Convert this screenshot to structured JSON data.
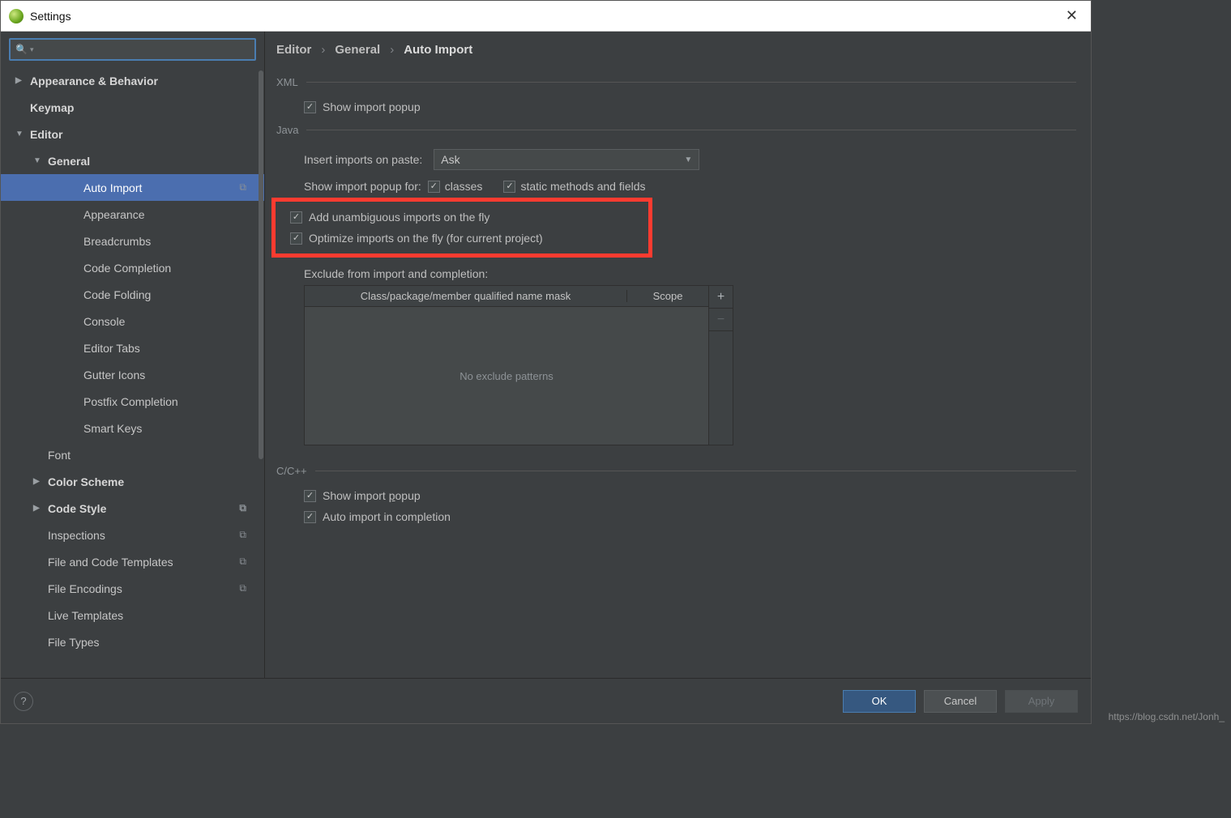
{
  "window": {
    "title": "Settings"
  },
  "breadcrumb": {
    "a": "Editor",
    "b": "General",
    "c": "Auto Import"
  },
  "sidebar": {
    "items": [
      {
        "label": "Appearance & Behavior",
        "bold": true,
        "arrow": "▶",
        "lvl": 0
      },
      {
        "label": "Keymap",
        "bold": true,
        "lvl": 0
      },
      {
        "label": "Editor",
        "bold": true,
        "arrow": "▼",
        "lvl": 0
      },
      {
        "label": "General",
        "bold": true,
        "arrow": "▼",
        "lvl": 1
      },
      {
        "label": "Auto Import",
        "lvl": 3,
        "selected": true,
        "proj": true
      },
      {
        "label": "Appearance",
        "lvl": 3
      },
      {
        "label": "Breadcrumbs",
        "lvl": 3
      },
      {
        "label": "Code Completion",
        "lvl": 3
      },
      {
        "label": "Code Folding",
        "lvl": 3
      },
      {
        "label": "Console",
        "lvl": 3
      },
      {
        "label": "Editor Tabs",
        "lvl": 3
      },
      {
        "label": "Gutter Icons",
        "lvl": 3
      },
      {
        "label": "Postfix Completion",
        "lvl": 3
      },
      {
        "label": "Smart Keys",
        "lvl": 3
      },
      {
        "label": "Font",
        "lvl": 1
      },
      {
        "label": "Color Scheme",
        "bold": true,
        "arrow": "▶",
        "lvl": 1
      },
      {
        "label": "Code Style",
        "bold": true,
        "arrow": "▶",
        "lvl": 1,
        "proj": true
      },
      {
        "label": "Inspections",
        "lvl": 1,
        "proj": true
      },
      {
        "label": "File and Code Templates",
        "lvl": 1,
        "proj": true
      },
      {
        "label": "File Encodings",
        "lvl": 1,
        "proj": true
      },
      {
        "label": "Live Templates",
        "lvl": 1
      },
      {
        "label": "File Types",
        "lvl": 1
      }
    ]
  },
  "xml": {
    "title": "XML",
    "show_import_popup": "Show import popup"
  },
  "java": {
    "title": "Java",
    "insert_label": "Insert imports on paste:",
    "insert_value": "Ask",
    "show_for_label": "Show import popup for:",
    "classes": "classes",
    "static": "static methods and fields",
    "unambig": "Add unambiguous imports on the fly",
    "optimize": "Optimize imports on the fly (for current project)",
    "exclude_label": "Exclude from import and completion:",
    "col1": "Class/package/member qualified name mask",
    "col2": "Scope",
    "empty": "No exclude patterns"
  },
  "cpp": {
    "title": "C/C++",
    "popup_pre": "Show import ",
    "popup_u": "p",
    "popup_post": "opup",
    "auto": "Auto import in completion"
  },
  "footer": {
    "ok": "OK",
    "cancel": "Cancel",
    "apply": "Apply"
  },
  "watermark": "https://blog.csdn.net/Jonh_"
}
